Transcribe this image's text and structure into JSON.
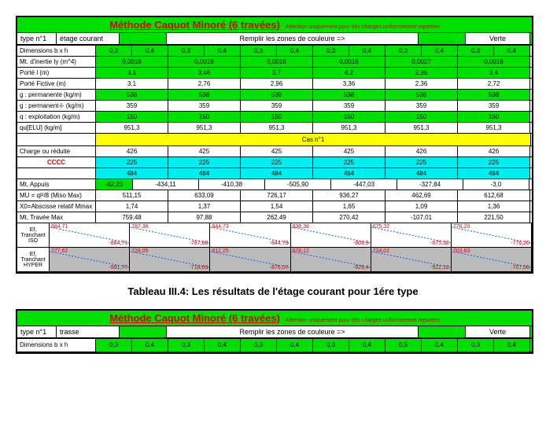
{
  "table1": {
    "title": "Méthode Caquot Minoré (6 travées)",
    "subtitle": "Attention uniquement pour des charges uniformement reparties",
    "type_label": "type n°1",
    "type_val": "étage courant",
    "fill_label": "Remplir les zones de couleure =>",
    "fill_color": "Verte",
    "rows": {
      "dim_label": "Dimensions b x h",
      "dim": [
        "0,3",
        "0,4",
        "0,3",
        "0,4",
        "0,3",
        "0,4",
        "0,3",
        "0,4",
        "0,3",
        "0,4",
        "0,3",
        "0,4"
      ],
      "inertie_label": "Mt. d'inertie Iy (m^4)",
      "inertie": [
        "0,0016",
        "0,0016",
        "0,0016",
        "0,0016",
        "0,0027",
        "0,0016"
      ],
      "porte_label": "Porté l (m)",
      "porte": [
        "3,1",
        "3,46",
        "3,7",
        "4,2",
        "2,96",
        "3,4"
      ],
      "fictive_label": "Porté Fictive (m)",
      "fictive": [
        "3,1",
        "2,76",
        "2,96",
        "3,36",
        "2,36",
        "2,72"
      ],
      "g_label": "g : permanente (kg/m)",
      "g": [
        "538",
        "538",
        "538",
        "538",
        "538",
        "538"
      ],
      "gp_label": "g : permanent-l- (kg/m)",
      "gp": [
        "359",
        "359",
        "359",
        "359",
        "359",
        "359"
      ],
      "q_label": "q : exploitation (kg/m)",
      "q": [
        "150",
        "150",
        "150",
        "150",
        "150",
        "150"
      ],
      "qu_label": "qu[ELU] (kg/m]",
      "qu": [
        "951,3",
        "951,3",
        "951,3",
        "951,3",
        "951,3",
        "951,3"
      ]
    },
    "cas_label": "Cas n°1",
    "cccc": "CCCC",
    "charge_label": "Charge ou réduite",
    "charge": [
      "426",
      "425",
      "425",
      "425",
      "426",
      "426"
    ],
    "cyan1": [
      "225",
      "225",
      "225",
      "225",
      "225",
      "225"
    ],
    "cyan2": [
      "484",
      "484",
      "484",
      "484",
      "484",
      "484"
    ],
    "appuis_label": "Mt, Appuis",
    "appuis_first": "-82,23",
    "appuis": [
      "-434,11",
      "-410,38",
      "-505,90",
      "-447,03",
      "-327,84",
      "-3,0"
    ],
    "mu_label": "MU = ql²/8 (Miso Max)",
    "mu": [
      "511,15",
      "633,09",
      "726,17",
      "936,27",
      "462,69",
      "612,68"
    ],
    "x0_label": "X0=Abscisse relatif Mmax",
    "x0": [
      "1,74",
      "1,37",
      "1,54",
      "1,65",
      "1,09",
      "1,36"
    ],
    "mt_label": "Mt, Travée Max",
    "mt": [
      "759,48",
      "97,88",
      "262,49",
      "270,42",
      "-107,01",
      "221,50"
    ],
    "shear_iso": {
      "label1": "Ef, Tranchant",
      "label2": "ISO",
      "vals": [
        [
          "884,71",
          "-884,71"
        ],
        [
          "787,38",
          "-787,68"
        ],
        [
          "844,73",
          "-844,73"
        ],
        [
          "938,38",
          "-908,9"
        ],
        [
          "675,32",
          "-675,32"
        ],
        [
          "776,20",
          "-776,20"
        ]
      ]
    },
    "shear_hyper": {
      "label1": "Ef, Tranchant",
      "label2": "HYPER",
      "vals": [
        [
          "777,62",
          "-991,77"
        ],
        [
          "728,05",
          "-718,63"
        ],
        [
          "812,25",
          "-876,07"
        ],
        [
          "978,12",
          "-929,4"
        ],
        [
          "724,02",
          "-922,12"
        ],
        [
          "703,63",
          "-707,06"
        ]
      ]
    }
  },
  "caption": "Tableau III.4: Les résultats de l'étage courant pour 1ére type",
  "table2": {
    "title": "Méthode Caquot Minoré (6 travées)",
    "subtitle": "Attention uniquement pour des charges uniformement reparties",
    "type_label": "type n°1",
    "type_val": "trasse",
    "fill_label": "Remplir les zones de couleure =>",
    "fill_color": "Verte",
    "dim_label": "Dimensions b x h",
    "dim": [
      "0,3",
      "0,4",
      "0,3",
      "0,4",
      "0,3",
      "0,4",
      "0,3",
      "0,4",
      "0,5",
      "0,4",
      "0,3",
      "0,4"
    ]
  }
}
